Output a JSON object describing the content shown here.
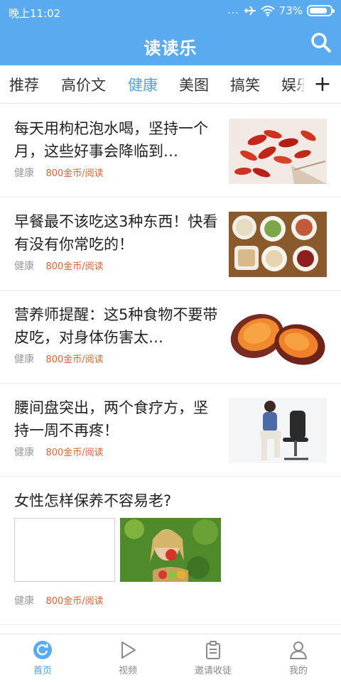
{
  "status_bar": {
    "time": "晚上11:02",
    "signal_dots": "...",
    "battery": "73%"
  },
  "header": {
    "title": "读读乐",
    "search_icon": "search-icon"
  },
  "tabs": {
    "items": [
      "推荐",
      "高价文",
      "健康",
      "美图",
      "搞笑",
      "娱乐"
    ],
    "active": "健康",
    "add_label": "+"
  },
  "feed": [
    {
      "title": "每天用枸杞泡水喝，坚持一个月，这些好事会降临到…",
      "category": "健康",
      "reward": "800金币/阅读",
      "thumb": "goji-berries-image"
    },
    {
      "title": "早餐最不该吃这3种东西！快看有没有你常吃的！",
      "category": "健康",
      "reward": "800金币/阅读",
      "thumb": "breakfast-bowls-image"
    },
    {
      "title": "营养师提醒：这5种食物不要带皮吃，对身体伤害太…",
      "category": "健康",
      "reward": "800金币/阅读",
      "thumb": "sweet-potato-image"
    },
    {
      "title": "腰间盘突出，两个食疗方，坚持一周不再疼！",
      "category": "健康",
      "reward": "800金币/阅读",
      "thumb": "back-pain-man-image"
    },
    {
      "title": "女性怎样保养不容易老?",
      "category": "健康",
      "reward": "800金币/阅读",
      "thumb": "woman-eating-apple-image"
    }
  ],
  "bottom_nav": {
    "items": [
      {
        "label": "首页",
        "icon": "home-refresh-icon",
        "active": true
      },
      {
        "label": "视频",
        "icon": "play-icon",
        "active": false
      },
      {
        "label": "邀请收徒",
        "icon": "clipboard-icon",
        "active": false
      },
      {
        "label": "我的",
        "icon": "person-icon",
        "active": false
      }
    ]
  },
  "colors": {
    "brand_blue": "#5aaaf0",
    "active_tab": "#4aa3e8",
    "reward_orange": "#e4622d"
  }
}
